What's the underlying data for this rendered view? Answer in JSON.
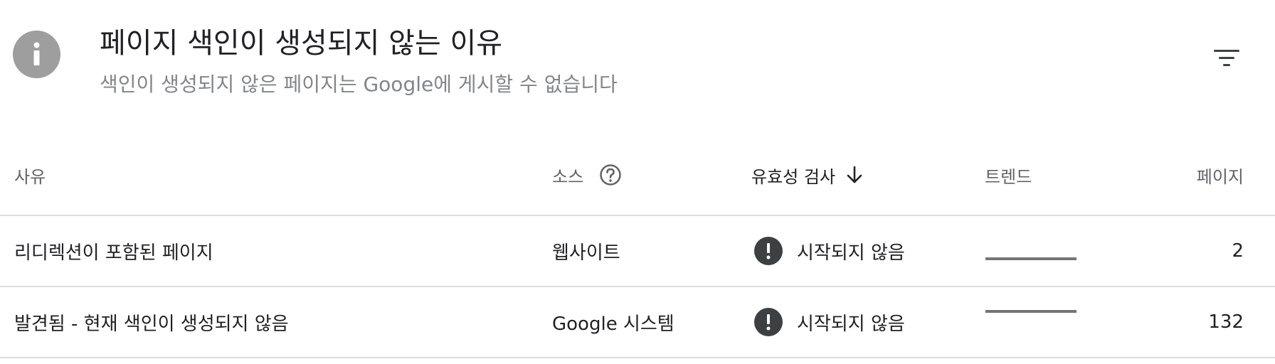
{
  "header": {
    "title": "페이지 색인이 생성되지 않는 이유",
    "subtitle": "색인이 생성되지 않은 페이지는 Google에 게시할 수 없습니다",
    "icon": "info-icon",
    "filter_icon": "filter-icon"
  },
  "table": {
    "columns": {
      "reason": "사유",
      "source": "소스",
      "validation": "유효성 검사",
      "trend": "트렌드",
      "pages": "페이지"
    },
    "sort": {
      "column": "validation",
      "direction": "descending"
    },
    "rows": [
      {
        "reason": "리디렉션이 포함된 페이지",
        "source": "웹사이트",
        "validation": "시작되지 않음",
        "pages": "2",
        "trend_level": 0.0
      },
      {
        "reason": "발견됨 - 현재 색인이 생성되지 않음",
        "source": "Google 시스템",
        "validation": "시작되지 않음",
        "pages": "132",
        "trend_level": 1.0
      }
    ]
  },
  "colors": {
    "header_icon_bg": "#9e9e9e",
    "status_icon_bg": "#3c4043",
    "trend_line": "#757575",
    "divider": "#dadce0",
    "muted_text": "#80868b"
  }
}
